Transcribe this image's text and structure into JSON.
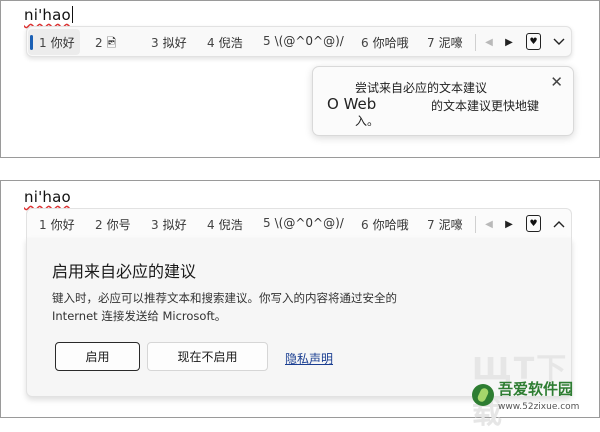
{
  "top": {
    "typed_text": "ni'hao",
    "candidates": [
      {
        "num": "1",
        "text": "你好"
      },
      {
        "num": "2",
        "text": "🖻"
      },
      {
        "num": "3",
        "text": "拟好"
      },
      {
        "num": "4",
        "text": "倪浩"
      },
      {
        "num": "5",
        "text": "\\(@^0^@)/"
      },
      {
        "num": "6",
        "text": "你哈哦"
      },
      {
        "num": "7",
        "text": "泥嚎"
      }
    ],
    "popup": {
      "line1": "尝试来自必应的文本建议",
      "line2_left": "O Web",
      "line2_right": "的文本建议更快地键",
      "line3": "入。"
    }
  },
  "bottom": {
    "typed_text": "ni'hao",
    "candidates": [
      {
        "num": "1",
        "text": "你好"
      },
      {
        "num": "2",
        "text": "你号"
      },
      {
        "num": "3",
        "text": "拟好"
      },
      {
        "num": "4",
        "text": "倪浩"
      },
      {
        "num": "5",
        "text": "\\(@^0^@)/"
      },
      {
        "num": "6",
        "text": "你哈哦"
      },
      {
        "num": "7",
        "text": "泥嚎"
      }
    ],
    "card": {
      "title": "启用来自必应的建议",
      "desc_line1": "键入时，必应可以推荐文本和搜索建议。你写入的内容将通过安全的",
      "desc_line2": "Internet 连接发送给 Microsoft。",
      "enable_label": "启用",
      "later_label": "现在不启用",
      "privacy_label": "隐私声明"
    }
  },
  "icons": {
    "prev": "chevron-left-icon",
    "next": "chevron-right-icon",
    "favorite": "heart-icon",
    "expand": "chevron-down-icon",
    "collapse": "chevron-up-icon",
    "close": "close-icon"
  },
  "watermark": {
    "big": "ЩТ下载",
    "name": "吾爱软件园",
    "url": "www.52zixue.com"
  },
  "colors": {
    "accent": "#1a5fb4",
    "link": "#1a3e91",
    "watermark_green": "#2e7d32"
  }
}
